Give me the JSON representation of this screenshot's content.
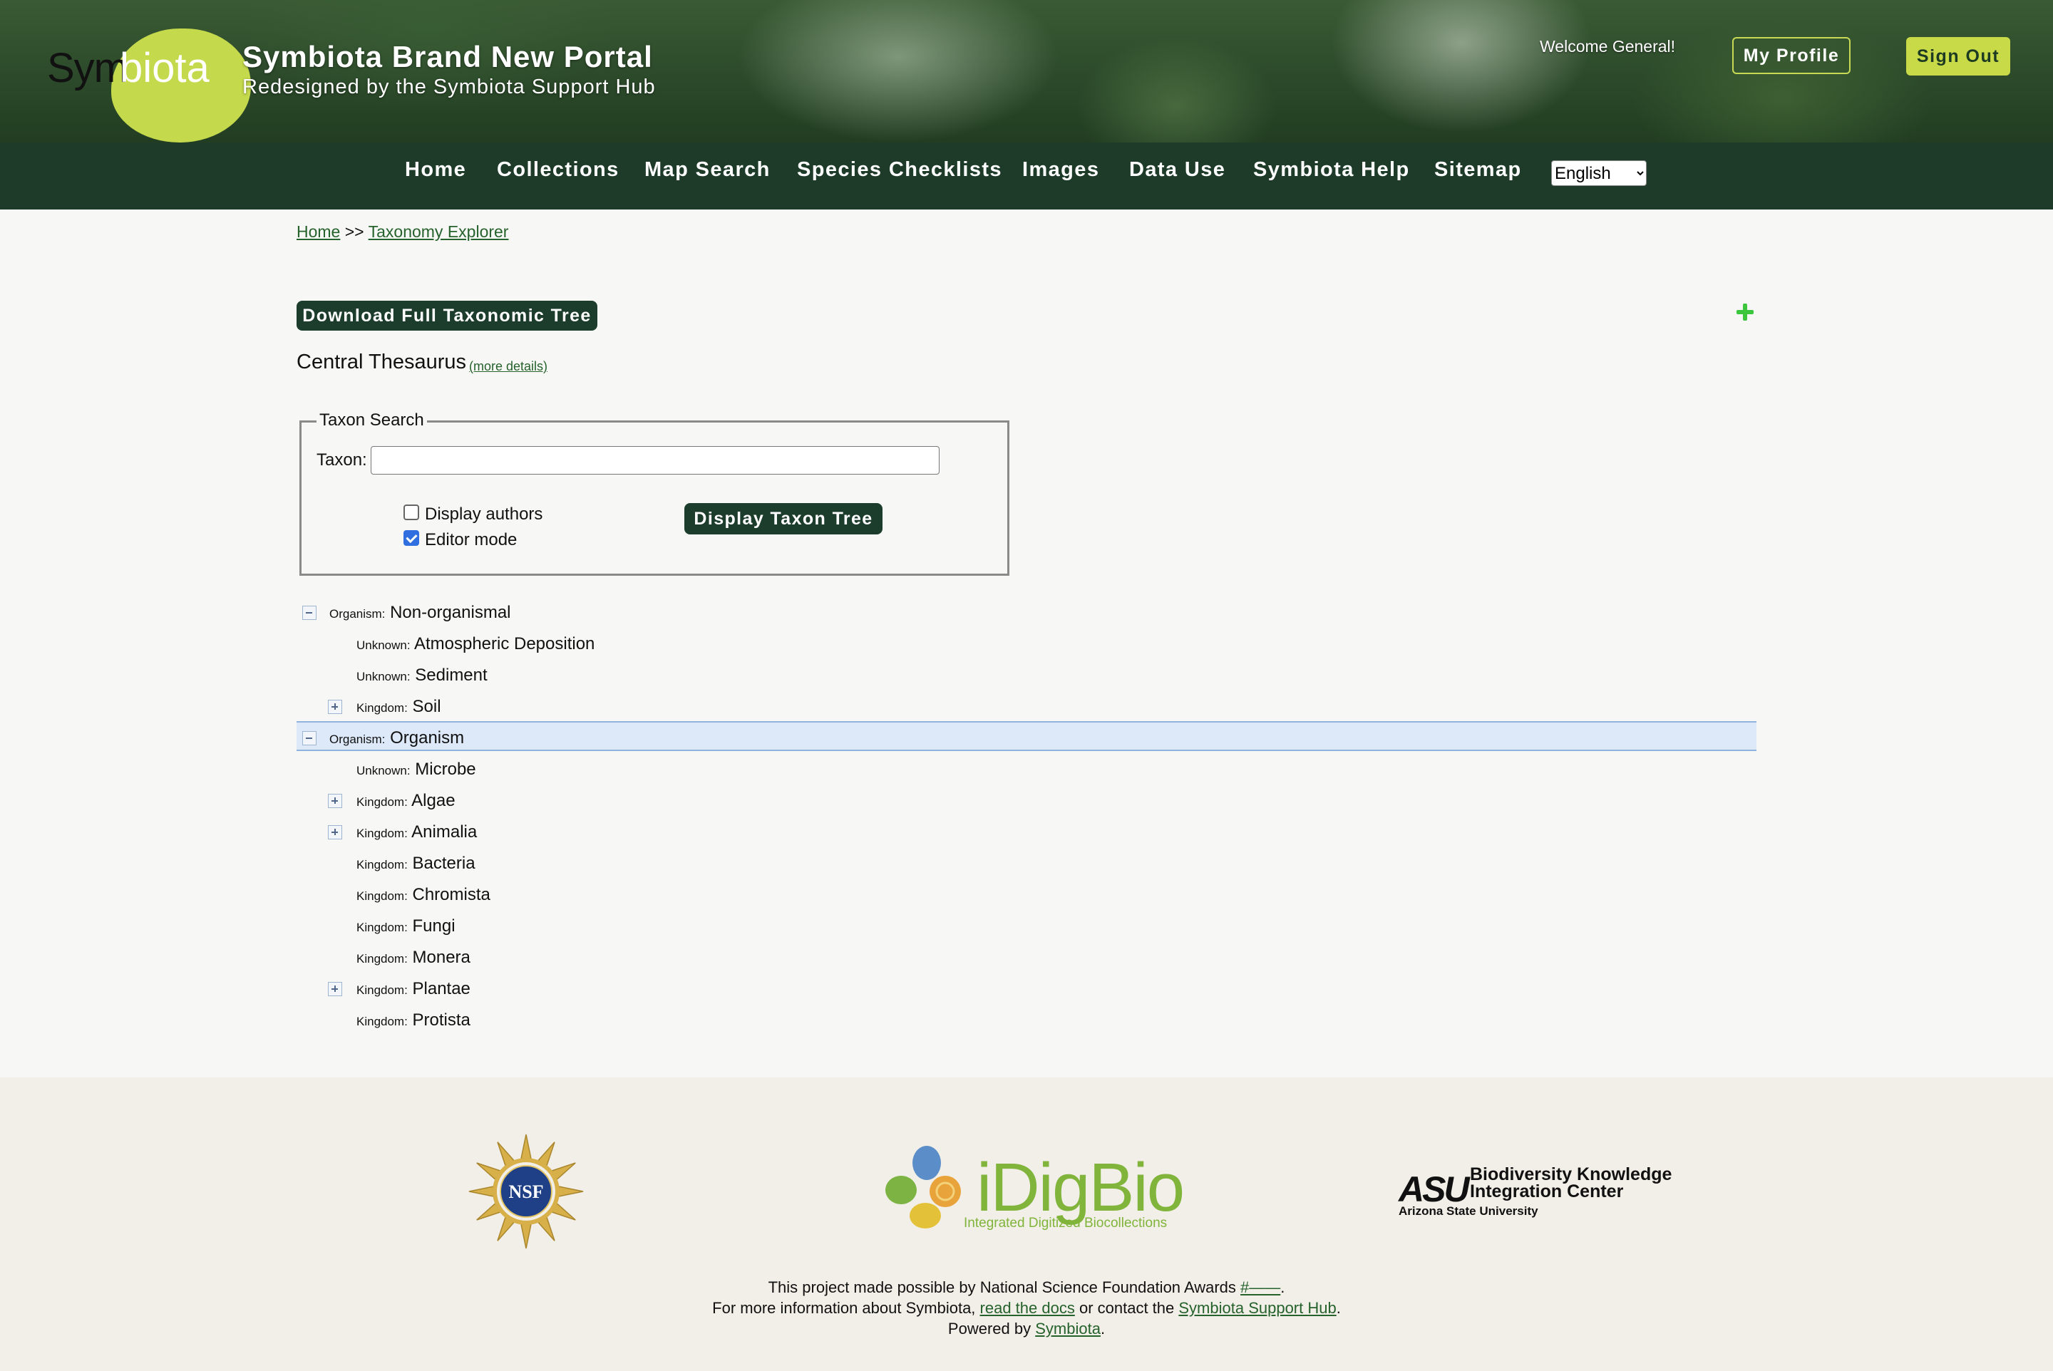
{
  "header": {
    "logo_sym": "Sym",
    "logo_biota": "biota",
    "title": "Symbiota Brand New Portal",
    "subtitle": "Redesigned by the Symbiota Support Hub",
    "welcome": "Welcome General!",
    "my_profile": "My Profile",
    "sign_out": "Sign Out"
  },
  "nav": {
    "items": [
      "Home",
      "Collections",
      "Map Search",
      "Species Checklists",
      "Images",
      "Data Use",
      "Symbiota Help",
      "Sitemap"
    ],
    "language": "English",
    "language_options": [
      "English"
    ]
  },
  "breadcrumb": {
    "home": "Home",
    "separator": ">>",
    "current": "Taxonomy Explorer"
  },
  "main": {
    "download_button": "Download Full Taxonomic Tree",
    "thesaurus_title": "Central Thesaurus",
    "more_details": "(more details)",
    "search": {
      "legend": "Taxon Search",
      "taxon_label": "Taxon:",
      "taxon_value": "",
      "display_authors_label": "Display authors",
      "display_authors_checked": false,
      "editor_mode_label": "Editor mode",
      "editor_mode_checked": true,
      "display_button": "Display Taxon Tree"
    },
    "tree": [
      {
        "rank": "Organism:",
        "name": "Non-organismal",
        "expander": "minus",
        "level": 0
      },
      {
        "rank": "Unknown:",
        "name": "Atmospheric Deposition",
        "expander": "",
        "level": 1
      },
      {
        "rank": "Unknown:",
        "name": "Sediment",
        "expander": "",
        "level": 1
      },
      {
        "rank": "Kingdom:",
        "name": "Soil",
        "expander": "plus",
        "level": 1
      },
      {
        "rank": "Organism:",
        "name": "Organism",
        "expander": "minus",
        "level": 0,
        "selected": true
      },
      {
        "rank": "Unknown:",
        "name": "Microbe",
        "expander": "",
        "level": 1
      },
      {
        "rank": "Kingdom:",
        "name": "Algae",
        "expander": "plus",
        "level": 1
      },
      {
        "rank": "Kingdom:",
        "name": "Animalia",
        "expander": "plus",
        "level": 1
      },
      {
        "rank": "Kingdom:",
        "name": "Bacteria",
        "expander": "",
        "level": 1
      },
      {
        "rank": "Kingdom:",
        "name": "Chromista",
        "expander": "",
        "level": 1
      },
      {
        "rank": "Kingdom:",
        "name": "Fungi",
        "expander": "",
        "level": 1
      },
      {
        "rank": "Kingdom:",
        "name": "Monera",
        "expander": "",
        "level": 1
      },
      {
        "rank": "Kingdom:",
        "name": "Plantae",
        "expander": "plus",
        "level": 1
      },
      {
        "rank": "Kingdom:",
        "name": "Protista",
        "expander": "",
        "level": 1
      }
    ]
  },
  "footer": {
    "nsf_logo": "NSF",
    "idigbio_logo": "iDigBio",
    "idigbio_sub": "Integrated Digitized Biocollections",
    "asu_mark": "ASU",
    "asu_title_line1": "Biodiversity Knowledge",
    "asu_title_line2": "Integration Center",
    "asu_sub": "Arizona State University",
    "line1_prefix": "This project made possible by National Science Foundation Awards ",
    "line1_link": "#——",
    "line1_suffix": ".",
    "line2_prefix": "For more information about Symbiota, ",
    "line2_link1": "read the docs",
    "line2_middle": " or contact the ",
    "line2_link2": "Symbiota Support Hub",
    "line2_suffix": ".",
    "line3_prefix": "Powered by ",
    "line3_link": "Symbiota",
    "line3_suffix": "."
  },
  "colors": {
    "nav_bg": "#1e3b2a",
    "accent_green": "#c8da48",
    "link_green": "#25622c",
    "selected_row": "#dde9f8"
  }
}
